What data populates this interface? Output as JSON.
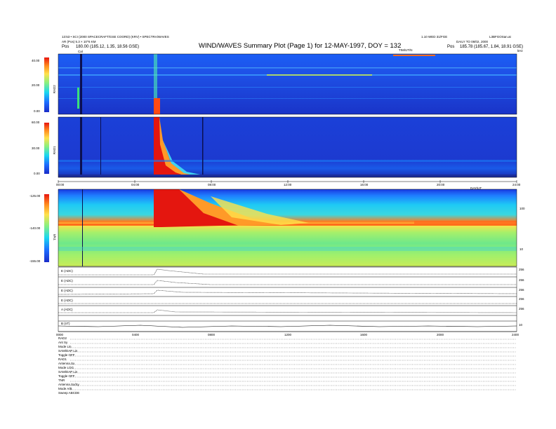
{
  "header": {
    "title": "WIND/WAVES Summary Plot (Page 1) for 12-MAY-1997, DOY = 132",
    "left_line1": "13:53 • SCI (2000 SPACECRAFT/GSE COORD) (KRV) • SPECTRA/WAVES",
    "left_line2": "AR (Pos) 5.3 × 10^6 KM",
    "left_pos_label": "Pos",
    "left_pos_value": "180.00 (185.12, 1.35, 18.56 GSE)",
    "right_line1": "1.10 WED 31/FGE",
    "right_line2": "DAILY TO 08/02, 2000",
    "right_id": "L3BFGOSan.at",
    "right_pos_label": "Pos",
    "right_pos_value": "185.78 (185.67, 1.84, 18.91 GSE)",
    "tnr_label": "TIM/UT/N",
    "unit_right": "kHz",
    "cal_marker": "Cal"
  },
  "panels": {
    "rad2": {
      "name": "RAD2",
      "ticks": [
        "40.00",
        "20.00",
        "0.00"
      ]
    },
    "rad1": {
      "name": "RAD1",
      "ticks": [
        "60.00",
        "30.00",
        "0.00"
      ]
    },
    "tnr": {
      "name": "TNR",
      "ticks": [
        "-125.00",
        "-140.00",
        "-155.00"
      ],
      "right_ticks": [
        "100",
        "10"
      ]
    },
    "xaxis_top": [
      "00:00",
      "04:00",
      "08:00",
      "12:00",
      "16:00",
      "20:00",
      "24:00"
    ],
    "xaxis_top_unit": "DAY/UT",
    "xaxis_bottom": [
      "0000",
      "0400",
      "0800",
      "1200",
      "1600",
      "2000",
      "2400"
    ]
  },
  "lineplots": [
    {
      "label": "E (ADC)",
      "right": "256"
    },
    {
      "label": "E (ADC)",
      "right": "256"
    },
    {
      "label": "E (ADC)",
      "right": "256"
    },
    {
      "label": "E (ADC)",
      "right": "256"
    },
    {
      "label": "A (ADC)",
      "right": "256"
    },
    {
      "label": "",
      "right": ""
    },
    {
      "label": "B (nT)",
      "right": "10"
    }
  ],
  "footer": [
    "RAD2",
    "Ant   Sy",
    "Mode  Lin",
    "SAM/DAP Lin",
    "Toggle  OFF",
    "RAD1",
    "Antenna  Sx",
    "Mode  LOG",
    "SAM/DAP Lin",
    "Toggle  OFF",
    "TNR",
    "Antenna  Sx/Sy",
    "Mode  A/B",
    "Sweep  ABCDE"
  ],
  "chart_data": {
    "type": "heatmap",
    "title": "WIND/WAVES Summary Plot (Page 1) for 12-MAY-1997, DOY = 132",
    "x_range": [
      "00:00",
      "24:00"
    ],
    "panels": [
      {
        "name": "RAD2",
        "ylim": [
          0,
          40
        ]
      },
      {
        "name": "RAD1",
        "ylim": [
          0,
          60
        ]
      },
      {
        "name": "TNR",
        "ylim": [
          -155,
          -125
        ]
      }
    ],
    "event_onset": "04:55",
    "colorscale": [
      "#1a2cc8",
      "#1c6dff",
      "#19d7f0",
      "#8cf07d",
      "#ffe14b",
      "#ff8a1e",
      "#e8160f"
    ]
  }
}
